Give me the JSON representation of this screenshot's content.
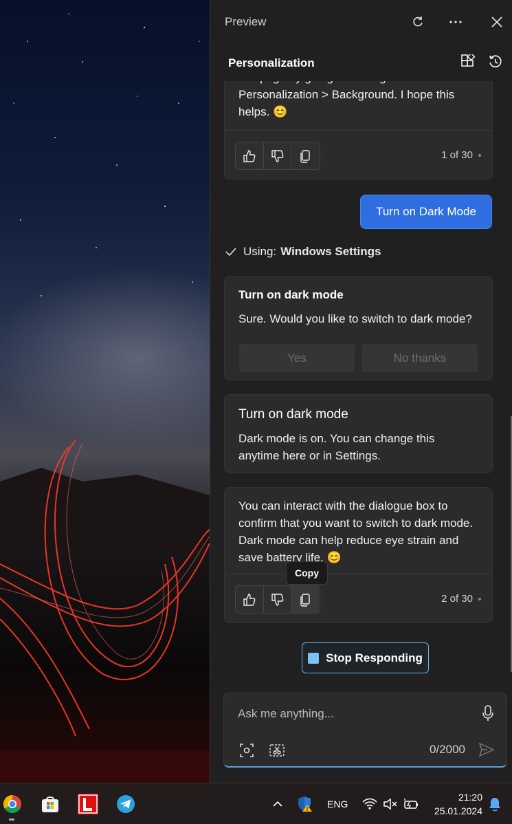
{
  "panel": {
    "window_title": "Preview",
    "page_title": "Personalization"
  },
  "messages": {
    "first": {
      "text": "this page by going to Settings > Personalization > Background. I hope this helps. 😊",
      "counter": "1 of 30"
    },
    "user": {
      "text": "Turn on Dark Mode"
    },
    "using": {
      "prefix": "Using:",
      "tool": "Windows Settings"
    },
    "action_card": {
      "title": "Turn on dark mode",
      "text": "Sure. Would you like to switch to dark mode?",
      "yes_label": "Yes",
      "no_label": "No thanks"
    },
    "result_card": {
      "title": "Turn on dark mode",
      "text": "Dark mode is on. You can change this anytime here or in Settings."
    },
    "last": {
      "text": "You can interact with the dialogue box to confirm that you want to switch to dark mode. Dark mode can help reduce eye strain and save battery life. 😊",
      "counter": "2 of 30",
      "tooltip": "Copy"
    },
    "stop_label": "Stop Responding"
  },
  "compose": {
    "placeholder": "Ask me anything...",
    "char_count": "0/2000"
  },
  "taskbar": {
    "language": "ENG",
    "time": "21:20",
    "date": "25.01.2024"
  },
  "colors": {
    "accent": "#2f6ee0",
    "panel_bg": "#202020",
    "card_bg": "#2b2b2b",
    "status_dot": "#4caf50"
  }
}
